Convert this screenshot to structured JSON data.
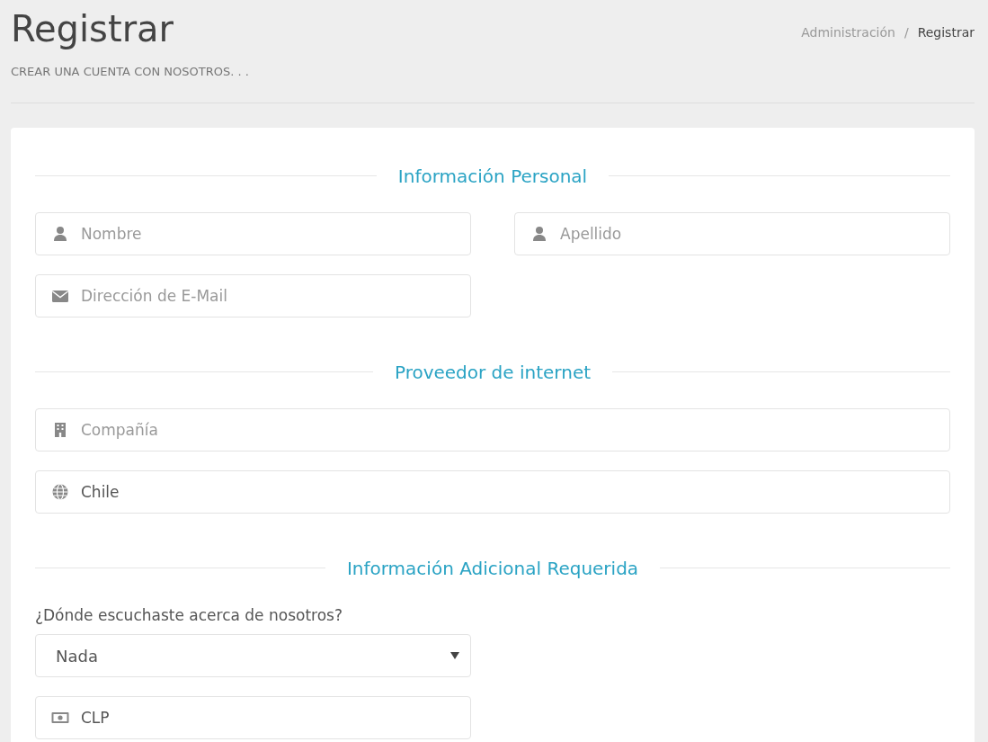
{
  "header": {
    "title": "Registrar",
    "subtitle": "CREAR UNA CUENTA CON NOSOTROS. . ."
  },
  "breadcrumb": {
    "separator": "/",
    "items": [
      {
        "label": "Administración",
        "active": false
      },
      {
        "label": "Registrar",
        "active": true
      }
    ]
  },
  "sections": [
    {
      "heading": "Información Personal",
      "fields": [
        {
          "kind": "input",
          "placeholder": "Nombre"
        },
        {
          "kind": "input",
          "placeholder": "Apellido"
        },
        {
          "kind": "input",
          "placeholder": "Dirección de E-Mail"
        }
      ]
    },
    {
      "heading": "Proveedor de internet",
      "fields": [
        {
          "kind": "input",
          "placeholder": "Compañía"
        },
        {
          "kind": "input",
          "value": "Chile"
        }
      ]
    },
    {
      "heading": "Información Adicional Requerida",
      "fields": [
        {
          "kind": "select",
          "label": "¿Dónde escuchaste acerca de nosotros?",
          "value": "Nada"
        },
        {
          "kind": "input",
          "value": "CLP"
        }
      ]
    }
  ]
}
